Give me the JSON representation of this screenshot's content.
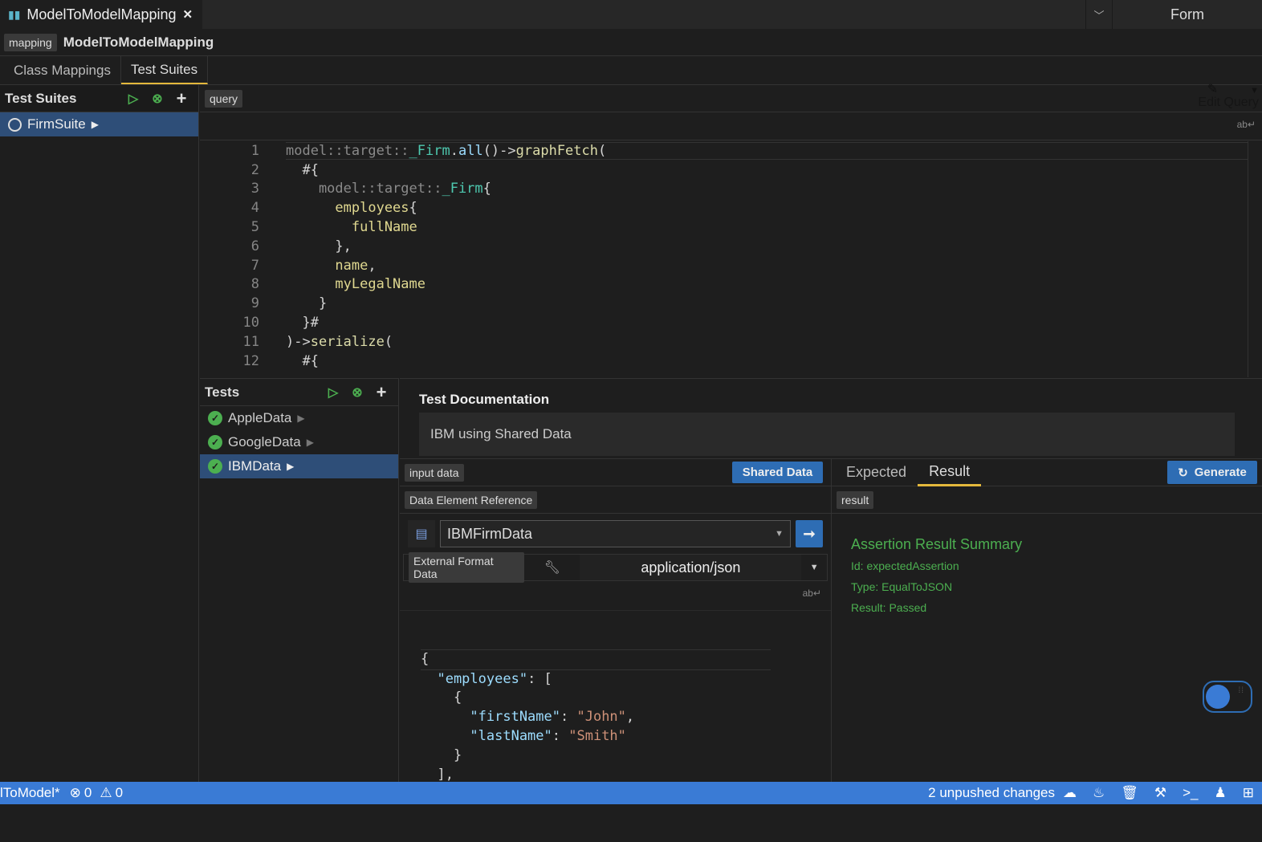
{
  "tab": {
    "title": "ModelToModelMapping",
    "icon": "map-icon",
    "close": "✕"
  },
  "mode_selector": {
    "label": "Form"
  },
  "header": {
    "type_chip": "mapping",
    "title": "ModelToModelMapping"
  },
  "subtabs": [
    {
      "label": "Class Mappings"
    },
    {
      "label": "Test Suites",
      "active": true
    }
  ],
  "test_suites": {
    "title": "Test Suites",
    "items": [
      {
        "label": "FirmSuite",
        "selected": true
      }
    ]
  },
  "query": {
    "chip": "query",
    "edit_label": "Edit Query",
    "lines": [
      "1",
      "2",
      "3",
      "4",
      "5",
      "6",
      "7",
      "8",
      "9",
      "10",
      "11",
      "12"
    ]
  },
  "tests": {
    "title": "Tests",
    "items": [
      {
        "label": "AppleData",
        "status": "passed"
      },
      {
        "label": "GoogleData",
        "status": "passed"
      },
      {
        "label": "IBMData",
        "status": "passed",
        "selected": true
      }
    ]
  },
  "documentation": {
    "title": "Test Documentation",
    "text": "IBM using Shared Data"
  },
  "input_data": {
    "chip": "input data",
    "shared_button": "Shared Data",
    "reference_chip": "Data Element Reference",
    "data_element": "IBMFirmData",
    "format_chip": "External Format Data",
    "content_type": "application/json"
  },
  "result_panel": {
    "tabs": [
      {
        "label": "Expected"
      },
      {
        "label": "Result",
        "active": true
      }
    ],
    "generate": "Generate",
    "chip": "result",
    "summary_title": "Assertion Result Summary",
    "id": "Id: expectedAssertion",
    "type": "Type: EqualToJSON",
    "result": "Result: Passed"
  },
  "status_bar": {
    "project": "lToModel*",
    "errors": "0",
    "warnings": "0",
    "changes": "2 unpushed changes"
  },
  "colors": {
    "accent": "#3a7bd5",
    "selection": "#2e4e78",
    "passed": "#4caf50",
    "tab_underline": "#e4b83c"
  }
}
